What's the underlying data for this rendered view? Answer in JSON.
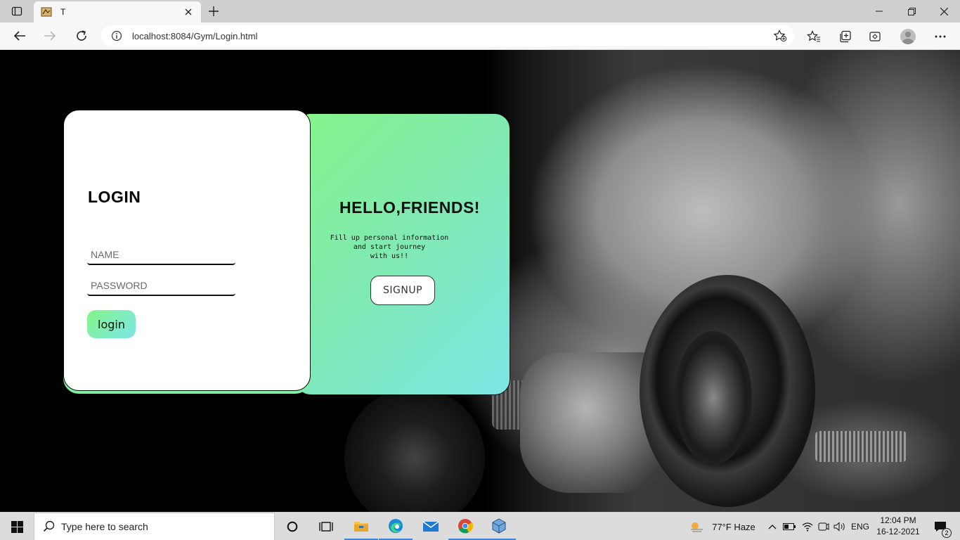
{
  "browser": {
    "tab_title": "T",
    "url_host": "localhost",
    "url_rest": ":8084/Gym/Login.html"
  },
  "login": {
    "title": "LOGIN",
    "name_placeholder": "NAME",
    "password_placeholder": "PASSWORD",
    "button_label": "login"
  },
  "signup": {
    "title": "HELLO,FRIENDS!",
    "text": "Fill up personal information\nand start journey\nwith us!!",
    "button_label": "SIGNUP"
  },
  "colors": {
    "accent_green": "#84f58a",
    "accent_cyan": "#7de6e6"
  },
  "taskbar": {
    "search_placeholder": "Type here to search",
    "weather": "77°F  Haze",
    "language": "ENG",
    "time": "12:04 PM",
    "date": "16-12-2021",
    "notification_count": "2"
  }
}
